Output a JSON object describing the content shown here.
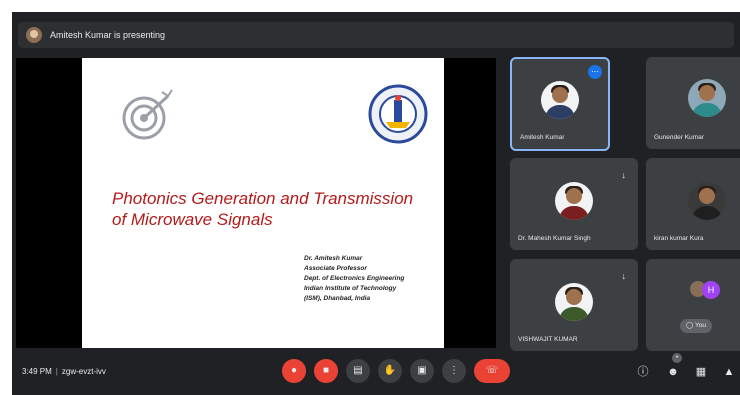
{
  "presenting_banner": "Amitesh Kumar is presenting",
  "slide": {
    "title_line1": "Photonics Generation and Transmission",
    "title_line2": "of Microwave Signals",
    "author_lines": [
      "Dr. Amitesh Kumar",
      "Associate Professor",
      "Dept. of Electronics Engineering",
      "Indian Institute of Technology",
      "(ISM), Dhanbad, India"
    ]
  },
  "participants": [
    {
      "name": "Amitesh Kumar"
    },
    {
      "name": "Gunender Kumar"
    },
    {
      "name": "Dr. Mahesh Kumar Singh"
    },
    {
      "name": "kiran kumar Kura"
    },
    {
      "name": "VISHWAJIT KUMAR"
    }
  ],
  "extra_tile": {
    "avatar_letter": "H",
    "label": "You"
  },
  "bottom": {
    "time": "3:49 PM",
    "meeting_code": "zgw-evzt-ivv"
  },
  "colors": {
    "accent_blue": "#1a73e8",
    "alert_red": "#ea4335",
    "title_red": "#b31b1b"
  }
}
